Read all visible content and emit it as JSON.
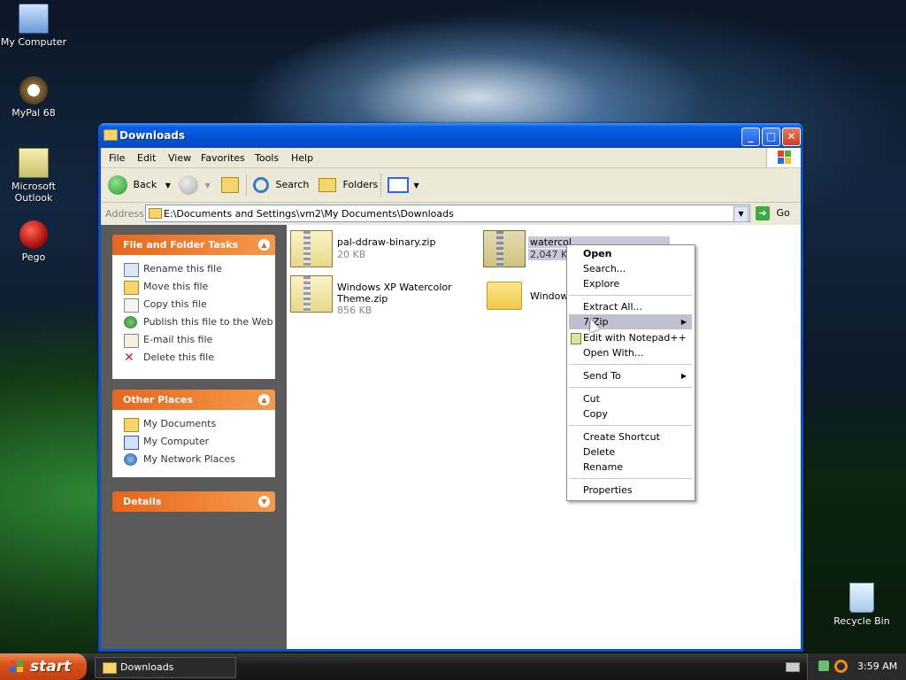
{
  "desktop": {
    "icons": [
      {
        "label": "My Computer"
      },
      {
        "label": "MyPal 68"
      },
      {
        "label": "Microsoft Outlook"
      },
      {
        "label": "Pego"
      },
      {
        "label": "Recycle Bin"
      }
    ]
  },
  "window": {
    "title": "Downloads",
    "menu": [
      "File",
      "Edit",
      "View",
      "Favorites",
      "Tools",
      "Help"
    ],
    "toolbar": {
      "back": "Back",
      "search": "Search",
      "folders": "Folders"
    },
    "address": {
      "label": "Address",
      "path": "E:\\Documents and Settings\\vm2\\My Documents\\Downloads",
      "go": "Go"
    }
  },
  "tasks": {
    "file_folder": {
      "title": "File and Folder Tasks",
      "items": [
        "Rename this file",
        "Move this file",
        "Copy this file",
        "Publish this file to the Web",
        "E-mail this file",
        "Delete this file"
      ]
    },
    "other_places": {
      "title": "Other Places",
      "items": [
        "My Documents",
        "My Computer",
        "My Network Places"
      ]
    },
    "details": {
      "title": "Details"
    }
  },
  "files": [
    {
      "name": "pal-ddraw-binary.zip",
      "size": "20 KB"
    },
    {
      "name": "watercol",
      "size": "2,047 KB"
    },
    {
      "name": "Windows XP Watercolor",
      "name2": "Theme.zip",
      "size": "856 KB"
    },
    {
      "name": "Windows"
    }
  ],
  "context_menu": {
    "items": [
      "Open",
      "Search...",
      "Explore",
      "Extract All...",
      "7-Zip",
      "Edit with Notepad++",
      "Open With...",
      "Send To",
      "Cut",
      "Copy",
      "Create Shortcut",
      "Delete",
      "Rename",
      "Properties"
    ],
    "highlighted": "7-Zip"
  },
  "taskbar": {
    "start": "start",
    "task": "Downloads",
    "clock": "3:59 AM"
  },
  "colors": {
    "accent_orange": "#e7661d",
    "titlebar_blue": "#0553d8"
  }
}
